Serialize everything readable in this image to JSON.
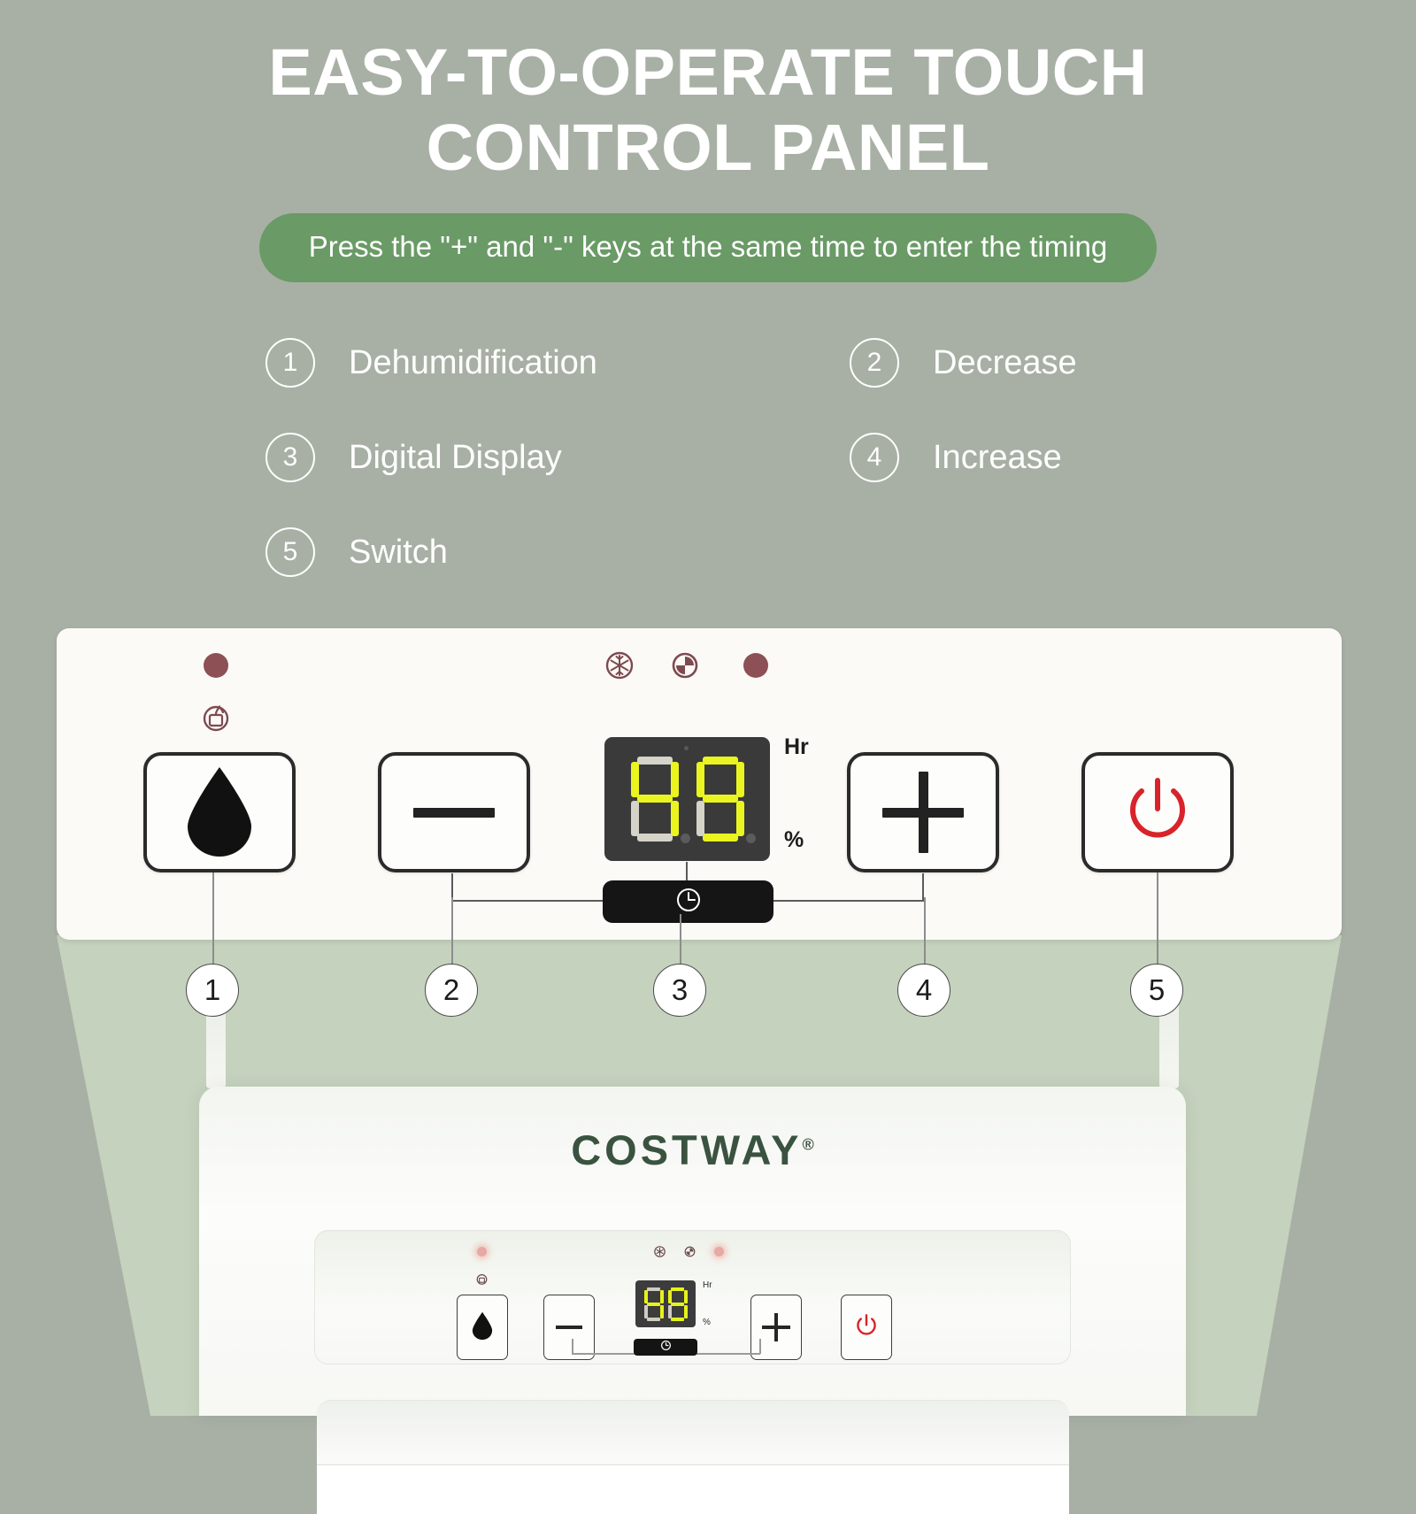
{
  "header": {
    "title_line1": "EASY-TO-OPERATE TOUCH",
    "title_line2": "CONTROL PANEL",
    "banner_text": "Press the \"+\" and \"-\" keys at the same time to enter the timing",
    "banner_color": "#6a9a66",
    "title_color": "#ffffff"
  },
  "legend": {
    "items": [
      {
        "num": "1",
        "label": "Dehumidification"
      },
      {
        "num": "2",
        "label": "Decrease"
      },
      {
        "num": "3",
        "label": "Digital Display"
      },
      {
        "num": "4",
        "label": "Increase"
      },
      {
        "num": "5",
        "label": "Switch"
      }
    ]
  },
  "panel": {
    "indicators": [
      {
        "name": "tank-full-indicator-light",
        "icon": "water-tank-icon",
        "color": "#8c5055"
      },
      {
        "name": "defrost-indicator-icon",
        "icon": "snowflake-icon",
        "color": "#7e4a4f"
      },
      {
        "name": "timer-indicator-icon",
        "icon": "clock-icon",
        "color": "#7e4a4f"
      },
      {
        "name": "timer-indicator-light",
        "icon": "dot-icon",
        "color": "#8c5055"
      }
    ],
    "buttons": [
      {
        "name": "dehumidify-button",
        "icon": "water-drop-icon",
        "color": "#1b1b1b"
      },
      {
        "name": "decrease-button",
        "icon": "minus-icon",
        "color": "#222222"
      },
      {
        "name": "increase-button",
        "icon": "plus-icon",
        "color": "#222222"
      },
      {
        "name": "power-button",
        "icon": "power-icon",
        "color": "#d8232a"
      }
    ],
    "display": {
      "value": "49",
      "digit1": "4",
      "digit2": "9",
      "unit_top": "Hr",
      "unit_bottom": "%",
      "segment_on_color": "#eaf520",
      "segment_off_color": "#d6d3c9",
      "background": "#3a3a3a"
    },
    "timer_bar": {
      "name": "timer-bar",
      "icon": "clock-icon"
    }
  },
  "callouts": [
    {
      "num": "1"
    },
    {
      "num": "2"
    },
    {
      "num": "3"
    },
    {
      "num": "4"
    },
    {
      "num": "5"
    }
  ],
  "product": {
    "brand": "COSTWAY",
    "trademark": "®",
    "brand_color": "#3a5340",
    "mini_display": {
      "digit1": "4",
      "digit2": "9",
      "unit_top": "Hr",
      "unit_bottom": "%"
    }
  },
  "background": {
    "page_color": "#a8b0a5",
    "cone_color": "#c5d2bd"
  }
}
